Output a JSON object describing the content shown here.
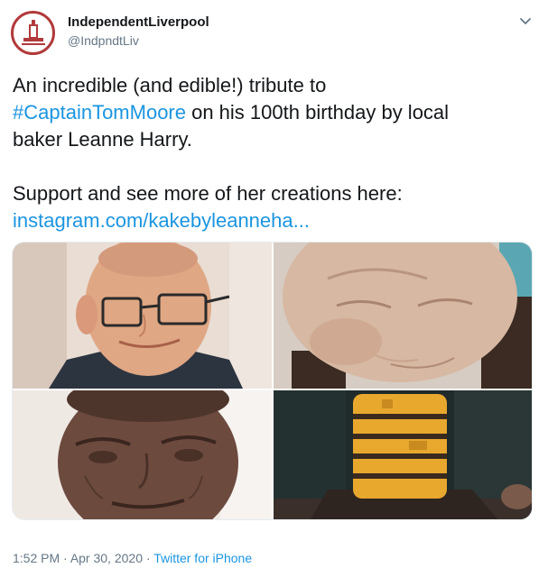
{
  "author": {
    "name": "IndependentLiverpool",
    "handle": "@IndpndtLiv"
  },
  "tweet": {
    "line1": "An incredible (and edible!) tribute to",
    "hashtag": "#CaptainTomMoore",
    "line2_rest": " on his 100th birthday by local",
    "line3": "baker Leanne Harry.",
    "line4": "Support and see more of her creations here:",
    "link": "instagram.com/kakebyleanneha..."
  },
  "meta": {
    "time": "1:52 PM",
    "separator1": " · ",
    "date": "Apr 30, 2020",
    "separator2": " · ",
    "source": "Twitter for iPhone"
  },
  "colors": {
    "link": "#1b95e0",
    "muted": "#657786",
    "avatar_ring": "#b23a3a"
  }
}
